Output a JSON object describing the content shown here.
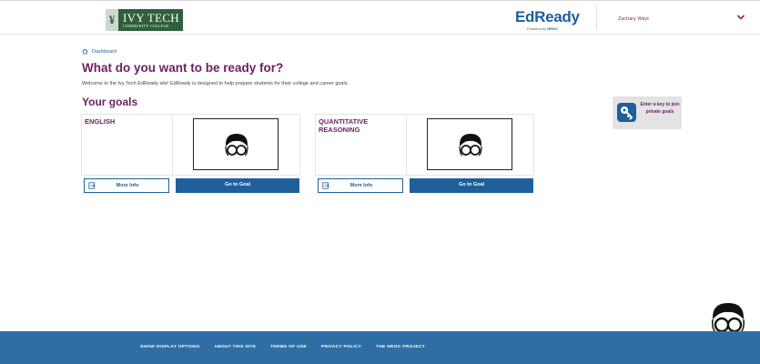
{
  "header": {
    "ivy_logo": {
      "name": "IVY TECH",
      "subtitle": "COMMUNITY COLLEGE",
      "mark": "¥"
    },
    "edready_logo": {
      "name": "EdReady",
      "powered_by": "Powered by",
      "nroc": "NROC"
    },
    "user": {
      "name": "Zachary Wayt"
    }
  },
  "breadcrumb": {
    "label": "Dashboard"
  },
  "main": {
    "title": "What do you want to be ready for?",
    "welcome": "Welcome to the Ivy Tech EdReady site! EdReady is designed to help prepare students for their college and career goals.",
    "goals_heading": "Your goals",
    "goals": [
      {
        "title": "ENGLISH",
        "more_info_label": "More Info",
        "go_label": "Go to Goal"
      },
      {
        "title": "QUANTITATIVE REASONING",
        "more_info_label": "More Info",
        "go_label": "Go to Goal"
      }
    ]
  },
  "key_card": {
    "text": "Enter a key to join private goals"
  },
  "footer": {
    "links": [
      "SHOW DISPLAY OPTIONS",
      "ABOUT THIS SITE",
      "TERMS OF USE",
      "PRIVACY POLICY",
      "THE NROC PROJECT"
    ]
  },
  "colors": {
    "brand_purple": "#6a1f63",
    "brand_blue": "#1e5f9c",
    "footer_blue": "#2f6ea5",
    "ivy_green": "#2f5f3c"
  }
}
